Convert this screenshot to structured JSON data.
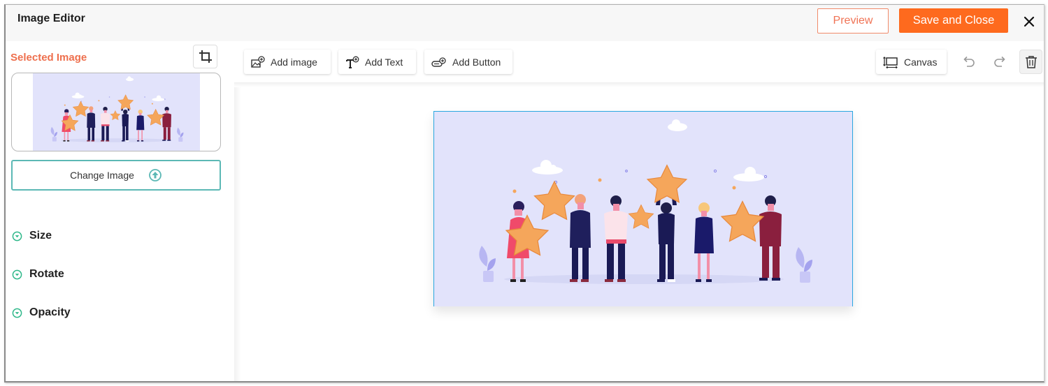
{
  "header": {
    "title": "Image Editor",
    "preview_label": "Preview",
    "save_label": "Save and Close",
    "close_icon": "close-icon"
  },
  "sidebar": {
    "selected_image_label": "Selected Image",
    "crop_icon": "crop-icon",
    "change_image_label": "Change Image",
    "upload_icon": "upload-icon",
    "sections": [
      {
        "label": "Size",
        "icon": "chevron-down-circle-icon"
      },
      {
        "label": "Rotate",
        "icon": "chevron-down-circle-icon"
      },
      {
        "label": "Opacity",
        "icon": "chevron-down-circle-icon"
      }
    ]
  },
  "toolbar": {
    "add_image_label": "Add image",
    "add_text_label": "Add Text",
    "add_button_label": "Add Button",
    "canvas_label": "Canvas",
    "undo_icon": "undo-icon",
    "redo_icon": "redo-icon",
    "delete_icon": "trash-icon"
  },
  "colors": {
    "accent_orange": "#fe6a1e",
    "preview_border": "#f08a6a",
    "selected_label": "#ee6f4d",
    "teal": "#5cb8b5",
    "section_icon": "#2fb88a",
    "canvas_selection": "#2aa7e0",
    "image_bg": "#e2e3fb"
  }
}
